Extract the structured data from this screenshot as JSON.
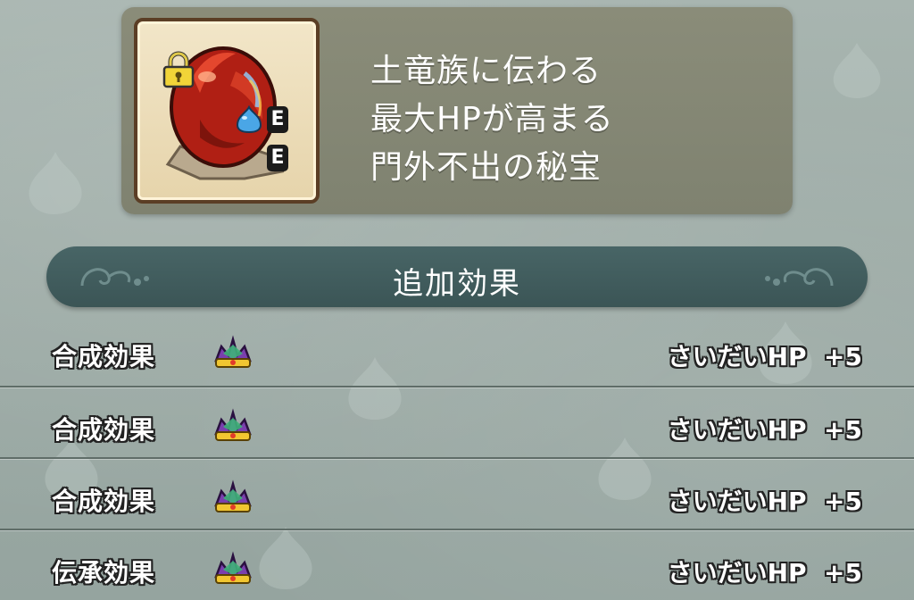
{
  "item": {
    "icon": "red-dragon-gem-icon",
    "locked": true,
    "badges": [
      "E",
      "E"
    ],
    "description_lines": [
      "土竜族に伝わる",
      "最大HPが高まる",
      "門外不出の秘宝"
    ]
  },
  "effects_section": {
    "title": "追加効果",
    "rows": [
      {
        "label": "合成効果",
        "icon": "crown-icon",
        "value": "さいだいHP  +5"
      },
      {
        "label": "合成効果",
        "icon": "crown-icon",
        "value": "さいだいHP  +5"
      },
      {
        "label": "合成効果",
        "icon": "crown-icon",
        "value": "さいだいHP  +5"
      },
      {
        "label": "伝承効果",
        "icon": "crown-icon",
        "value": "さいだいHP  +5"
      }
    ]
  },
  "colors": {
    "background": "#9eaca7",
    "panel": "#8a8c79",
    "banner": "#3b5556",
    "gem_red": "#c7261a"
  }
}
